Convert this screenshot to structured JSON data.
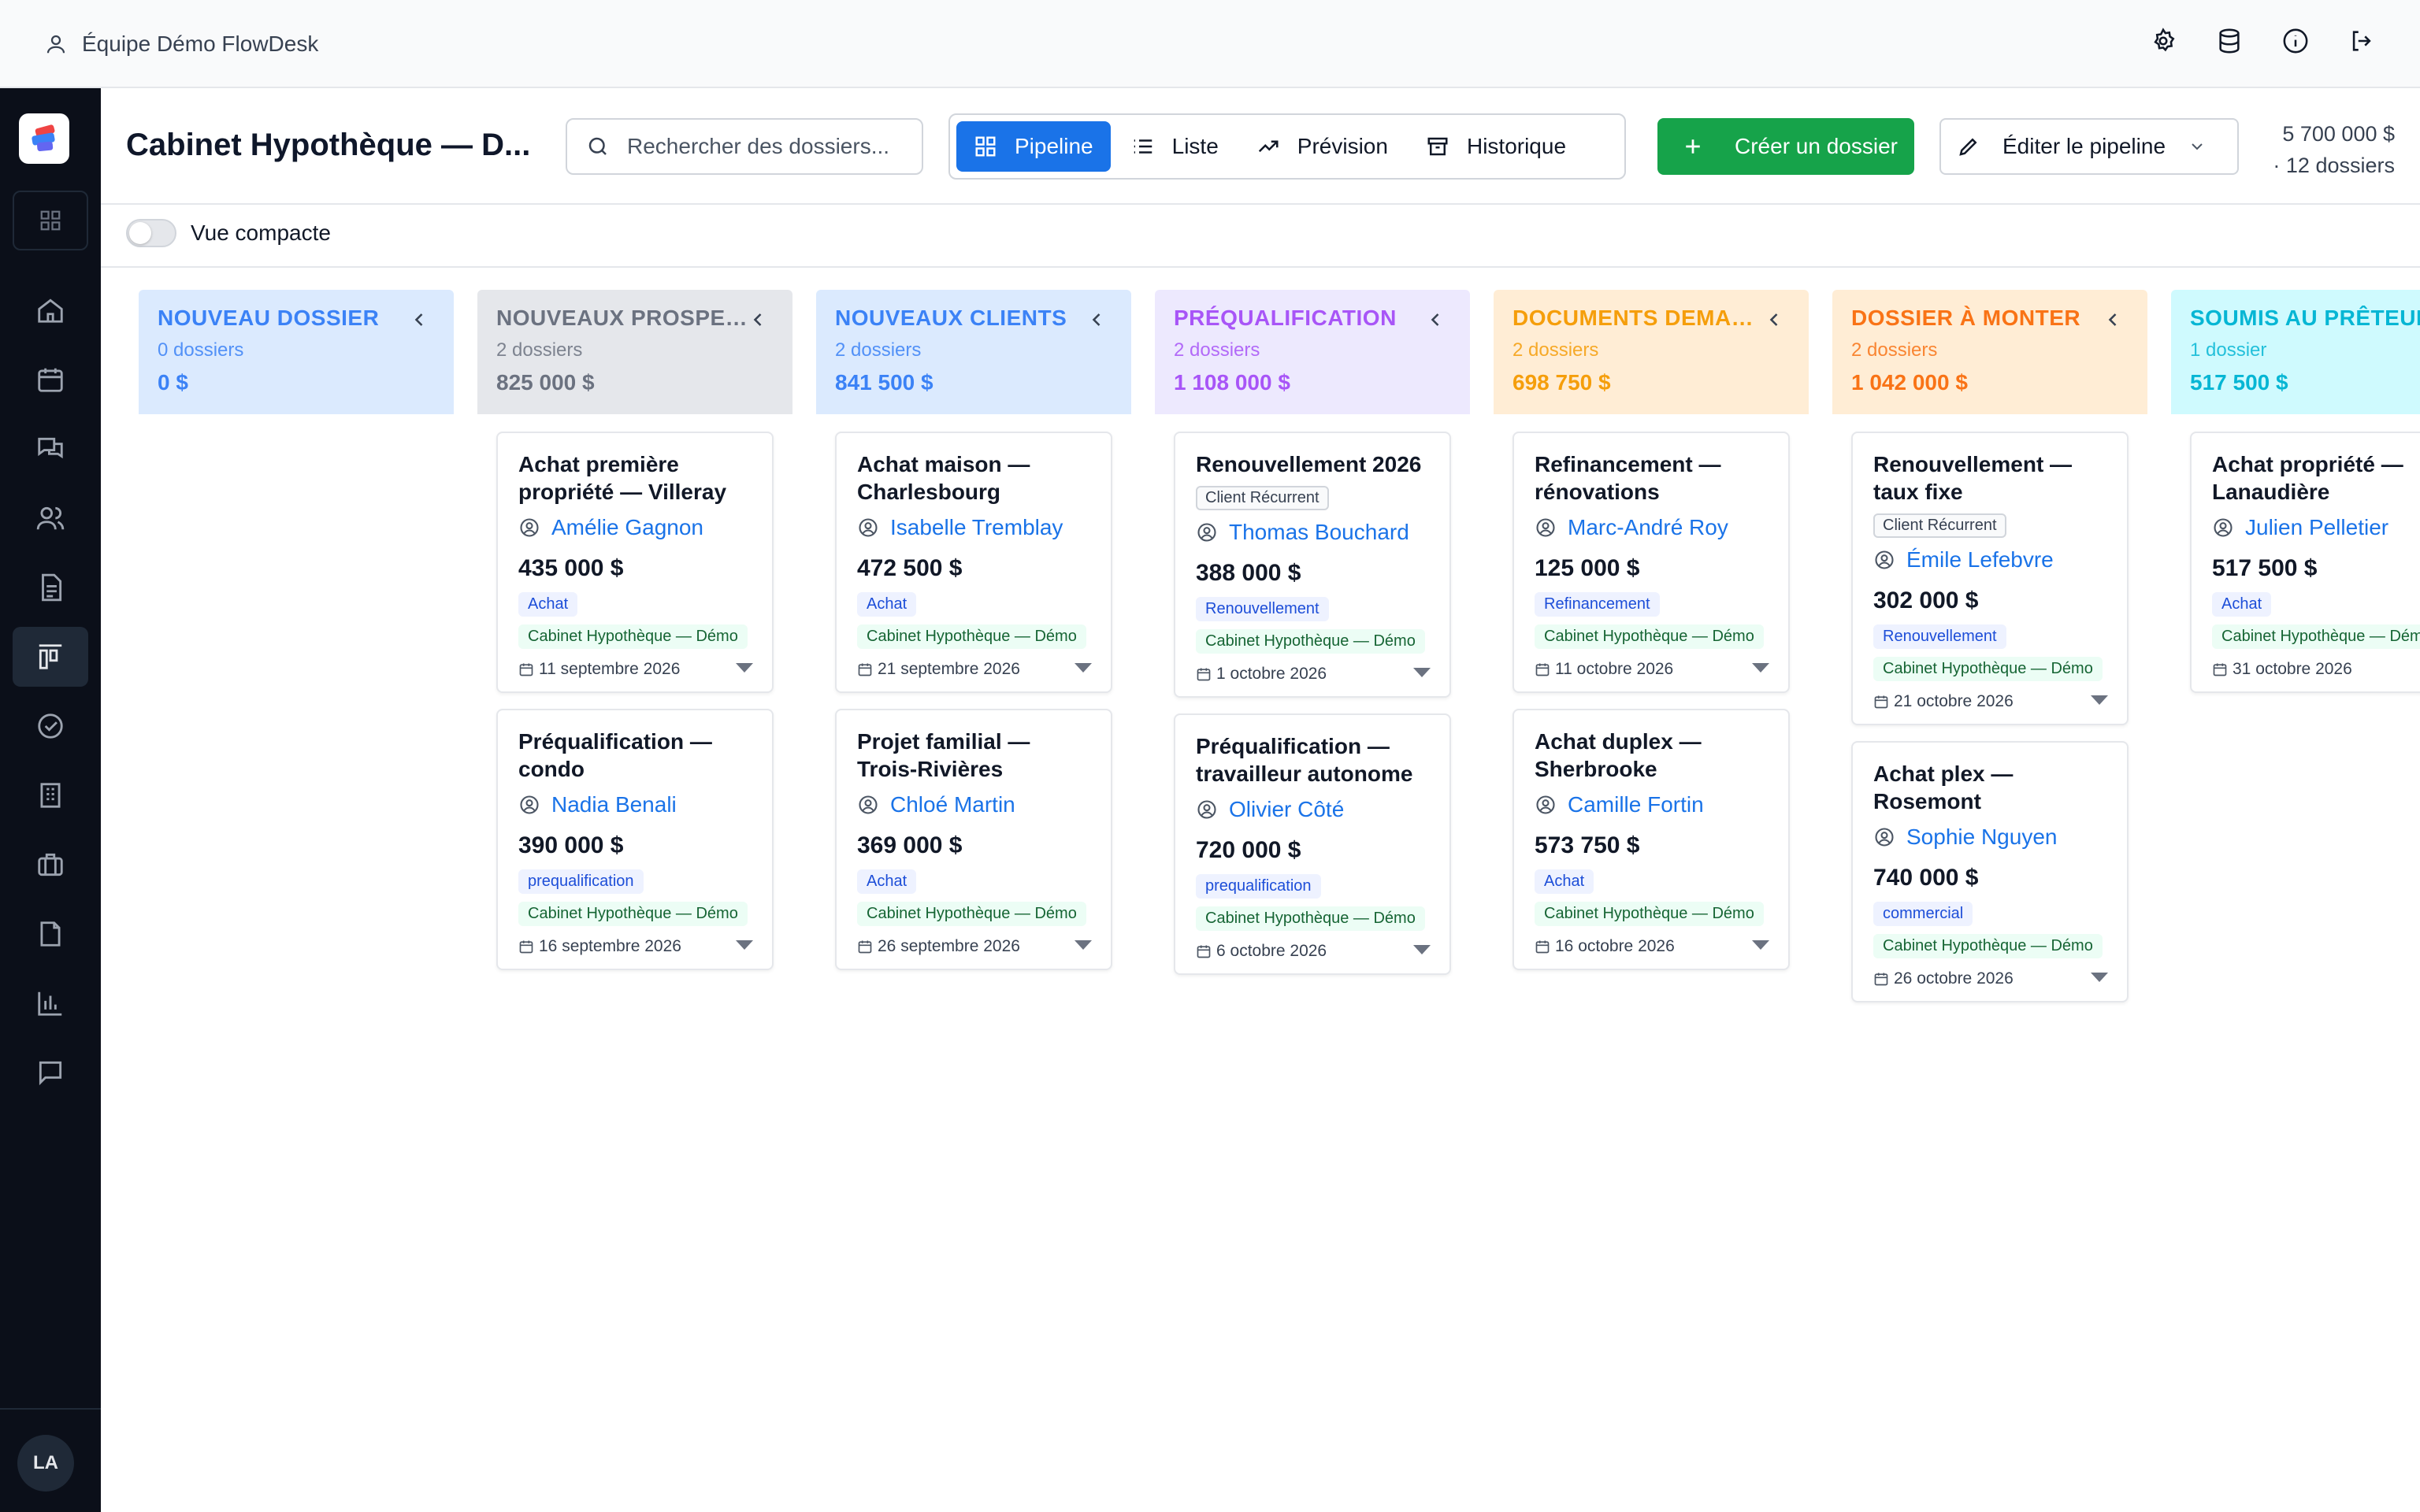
{
  "topbar": {
    "team_name": "Équipe Démo FlowDesk"
  },
  "user": {
    "initials": "LA"
  },
  "header": {
    "title": "Cabinet Hypothèque — D...",
    "search_placeholder": "Rechercher des dossiers...",
    "views": [
      "Pipeline",
      "Liste",
      "Prévision",
      "Historique"
    ],
    "create_label": "Créer un dossier",
    "edit_label": "Éditer le pipeline",
    "total_amount": "5 700 000 $",
    "total_count": "· 12 dossiers"
  },
  "compact_label": "Vue compacte",
  "columns": [
    {
      "title": "NOUVEAU DOSSIER",
      "count": "0 dossiers",
      "amount": "0 $",
      "bg": "#dbeafe",
      "fg": "#3b82f6",
      "cards": []
    },
    {
      "title": "NOUVEAUX PROSPECTS",
      "count": "2 dossiers",
      "amount": "825 000 $",
      "bg": "#e5e7eb",
      "fg": "#6b7280",
      "cards": [
        {
          "title": "Achat première propriété — Villeray",
          "client": "Amélie Gagnon",
          "amount": "435 000 $",
          "type": "Achat",
          "org": "Cabinet Hypothèque — Démo",
          "date": "11 septembre 2026"
        },
        {
          "title": "Préqualification — condo",
          "client": "Nadia Benali",
          "amount": "390 000 $",
          "type": "prequalification",
          "org": "Cabinet Hypothèque — Démo",
          "date": "16 septembre 2026"
        }
      ]
    },
    {
      "title": "NOUVEAUX CLIENTS",
      "count": "2 dossiers",
      "amount": "841 500 $",
      "bg": "#dbeafe",
      "fg": "#3b82f6",
      "cards": [
        {
          "title": "Achat maison — Charlesbourg",
          "client": "Isabelle Tremblay",
          "amount": "472 500 $",
          "type": "Achat",
          "org": "Cabinet Hypothèque — Démo",
          "date": "21 septembre 2026"
        },
        {
          "title": "Projet familial — Trois-Rivières",
          "client": "Chloé Martin",
          "amount": "369 000 $",
          "type": "Achat",
          "org": "Cabinet Hypothèque — Démo",
          "date": "26 septembre 2026"
        }
      ]
    },
    {
      "title": "PRÉQUALIFICATION",
      "count": "2 dossiers",
      "amount": "1 108 000 $",
      "bg": "#ede9fe",
      "fg": "#a855f7",
      "cards": [
        {
          "title": "Renouvellement 2026",
          "recurrent": "Client Récurrent",
          "client": "Thomas Bouchard",
          "amount": "388 000 $",
          "type": "Renouvellement",
          "org": "Cabinet Hypothèque — Démo",
          "date": "1 octobre 2026"
        },
        {
          "title": "Préqualification — travailleur autonome",
          "client": "Olivier Côté",
          "amount": "720 000 $",
          "type": "prequalification",
          "org": "Cabinet Hypothèque — Démo",
          "date": "6 octobre 2026"
        }
      ]
    },
    {
      "title": "DOCUMENTS DEMANDÉS",
      "count": "2 dossiers",
      "amount": "698 750 $",
      "bg": "#ffedd5",
      "fg": "#f59e0b",
      "cards": [
        {
          "title": "Refinancement — rénovations",
          "client": "Marc-André Roy",
          "amount": "125 000 $",
          "type": "Refinancement",
          "org": "Cabinet Hypothèque — Démo",
          "date": "11 octobre 2026"
        },
        {
          "title": "Achat duplex — Sherbrooke",
          "client": "Camille Fortin",
          "amount": "573 750 $",
          "type": "Achat",
          "org": "Cabinet Hypothèque — Démo",
          "date": "16 octobre 2026"
        }
      ]
    },
    {
      "title": "DOSSIER À MONTER",
      "count": "2 dossiers",
      "amount": "1 042 000 $",
      "bg": "#ffedd5",
      "fg": "#f97316",
      "cards": [
        {
          "title": "Renouvellement — taux fixe",
          "recurrent": "Client Récurrent",
          "client": "Émile Lefebvre",
          "amount": "302 000 $",
          "type": "Renouvellement",
          "org": "Cabinet Hypothèque — Démo",
          "date": "21 octobre 2026"
        },
        {
          "title": "Achat plex — Rosemont",
          "client": "Sophie Nguyen",
          "amount": "740 000 $",
          "type": "commercial",
          "org": "Cabinet Hypothèque — Démo",
          "date": "26 octobre 2026"
        }
      ]
    },
    {
      "title": "SOUMIS AU PRÊTEUR",
      "count": "1 dossier",
      "amount": "517 500 $",
      "bg": "#cffafe",
      "fg": "#06b6d4",
      "cards": [
        {
          "title": "Achat propriété — Lanaudière",
          "client": "Julien Pelletier",
          "amount": "517 500 $",
          "type": "Achat",
          "org": "Cabinet Hypothèque — Démo",
          "date": "31 octobre 2026"
        }
      ]
    }
  ]
}
